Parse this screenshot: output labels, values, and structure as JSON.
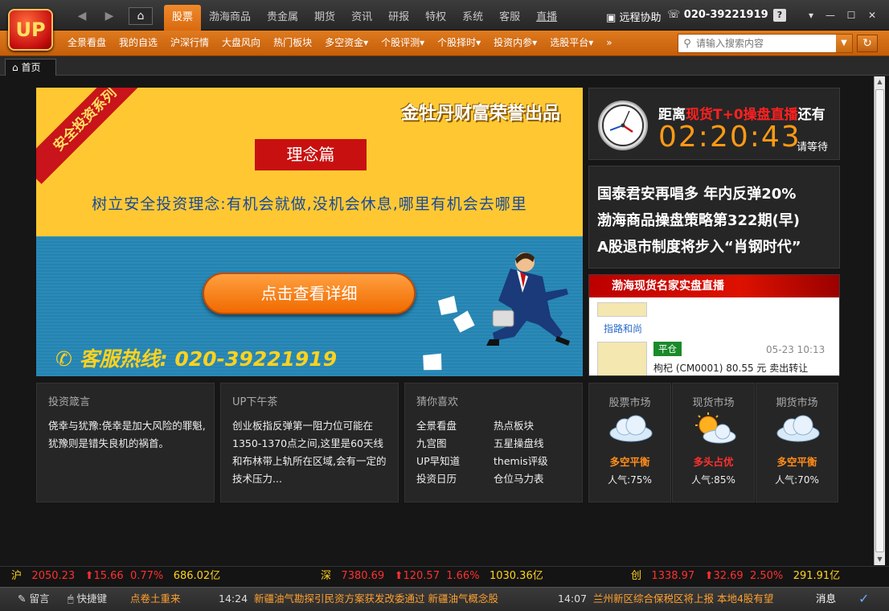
{
  "app": {
    "logo_text": "UP"
  },
  "titlebar": {
    "main_tabs": [
      "股票",
      "渤海商品",
      "贵金属",
      "期货",
      "资讯",
      "研报",
      "特权",
      "系统",
      "客服",
      "直播"
    ],
    "active_tab": 0,
    "remote_help": "远程协助",
    "phone": "020-39221919",
    "help": "?"
  },
  "subnav": {
    "items": [
      "全景看盘",
      "我的自选",
      "沪深行情",
      "大盘风向",
      "热门板块",
      "多空资金▾",
      "个股评测▾",
      "个股择时▾",
      "投资内参▾",
      "选股平台▾",
      "»"
    ],
    "search_placeholder": "请输入搜索内容"
  },
  "tabs": {
    "home": "首页"
  },
  "banner": {
    "ribbon": "安全投资系列",
    "brand": "金牡丹财富荣誉出品",
    "concept": "理念篇",
    "slogan": "树立安全投资理念:有机会就做,没机会休息,哪里有机会去哪里",
    "detail_button": "点击查看详细",
    "hotline": "客服热线: 020-39221919"
  },
  "countdown": {
    "prefix": "距离",
    "highlight": "现货T+0操盘直播",
    "suffix": "还有",
    "time": "02:20:43",
    "wait": "请等待"
  },
  "headlines": [
    "国泰君安再唱多 年内反弹20%",
    "渤海商品操盘策略第322期(早)",
    "A股退市制度将步入“肖钢时代”"
  ],
  "live": {
    "title": "渤海现货名家实盘直播",
    "entries": [
      {
        "name": "指路和尚",
        "tag": "",
        "time": "",
        "text": ""
      },
      {
        "name": "",
        "tag": "平仓",
        "time": "05-23 10:13",
        "text": "枸杞 (CM0001) 80.55 元 卖出转让"
      }
    ]
  },
  "panels": {
    "quote": {
      "title": "投资箴言",
      "text": "侥幸与犹豫:侥幸是加大风险的罪魁,犹豫则是错失良机的祸首。"
    },
    "tea": {
      "title": "UP下午茶",
      "text": "创业板指反弹第一阻力位可能在1350-1370点之间,这里是60天线和布林带上轨所在区域,会有一定的技术压力..."
    },
    "guess": {
      "title": "猜你喜欢",
      "left": [
        "全景看盘",
        "九宫图",
        "UP早知道",
        "投资日历"
      ],
      "right": [
        "热点板块",
        "五星操盘线",
        "themis评级",
        "仓位马力表"
      ]
    }
  },
  "markets": [
    {
      "title": "股票市场",
      "state": "多空平衡",
      "popularity": "人气:75%",
      "state_color": "#ff8c1a",
      "weather": "cloudy"
    },
    {
      "title": "现货市场",
      "state": "多头占优",
      "popularity": "人气:85%",
      "state_color": "#ff3030",
      "weather": "sunny"
    },
    {
      "title": "期货市场",
      "state": "多空平衡",
      "popularity": "人气:70%",
      "state_color": "#ff8c1a",
      "weather": "cloudy"
    }
  ],
  "ticker": {
    "sh": {
      "label": "沪",
      "value": "2050.23",
      "change": "⬆15.66",
      "pct": "0.77%",
      "amount": "686.02亿"
    },
    "sz": {
      "label": "深",
      "value": "7380.69",
      "change": "⬆120.57",
      "pct": "1.66%",
      "amount": "1030.36亿"
    },
    "cy": {
      "label": "创",
      "value": "1338.97",
      "change": "⬆32.69",
      "pct": "2.50%",
      "amount": "291.91亿"
    }
  },
  "status": {
    "message": "留言",
    "shortcut": "快捷键",
    "news": [
      {
        "time": "",
        "text": "点卷土重来"
      },
      {
        "time": "14:24",
        "text": "新疆油气勘探引民资方案获发改委通过 新疆油气概念股"
      },
      {
        "time": "14:07",
        "text": "兰州新区综合保税区将上报 本地4股有望"
      }
    ],
    "news_btn": "消息"
  },
  "colors": {
    "accent": "#e07a1e",
    "up": "#ff3030",
    "yellow": "#ffd21e",
    "banner_yellow": "#ffc832",
    "banner_blue": "#2a8ab8"
  }
}
